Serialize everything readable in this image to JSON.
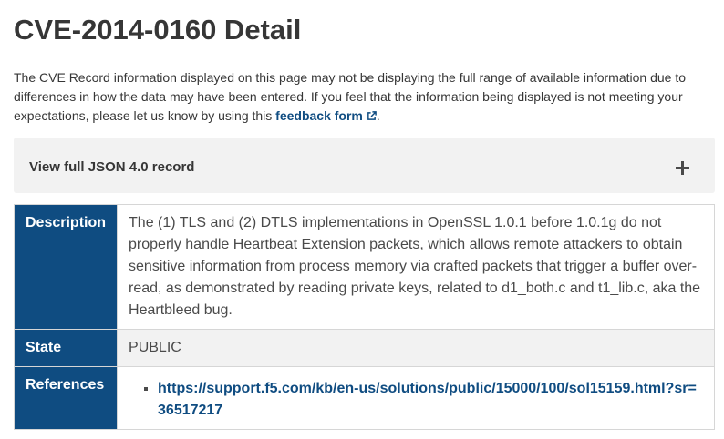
{
  "page": {
    "title": "CVE-2014-0160 Detail"
  },
  "notice": {
    "text": "The CVE Record information displayed on this page may not be displaying the full range of available information due to differences in how the data may have been entered. If you feel that the information being displayed is not meeting your expectations, please let us know by using this ",
    "link_label": "feedback form",
    "link_icon": "external-link-icon",
    "trailing": "."
  },
  "json_record": {
    "label": "View full JSON 4.0 record",
    "icon": "plus-icon"
  },
  "details": {
    "description_label": "Description",
    "description": "The (1) TLS and (2) DTLS implementations in OpenSSL 1.0.1 before 1.0.1g do not properly handle Heartbeat Extension packets, which allows remote attackers to obtain sensitive information from process memory via crafted packets that trigger a buffer over-read, as demonstrated by reading private keys, related to d1_both.c and t1_lib.c, aka the Heartbleed bug.",
    "state_label": "State",
    "state": "PUBLIC",
    "references_label": "References",
    "references": [
      "https://support.f5.com/kb/en-us/solutions/public/15000/100/sol15159.html?sr=36517217"
    ]
  },
  "colors": {
    "header_bg": "#0f4c81",
    "link": "#0f4c81",
    "accordion_bg": "#f2f2f2"
  }
}
